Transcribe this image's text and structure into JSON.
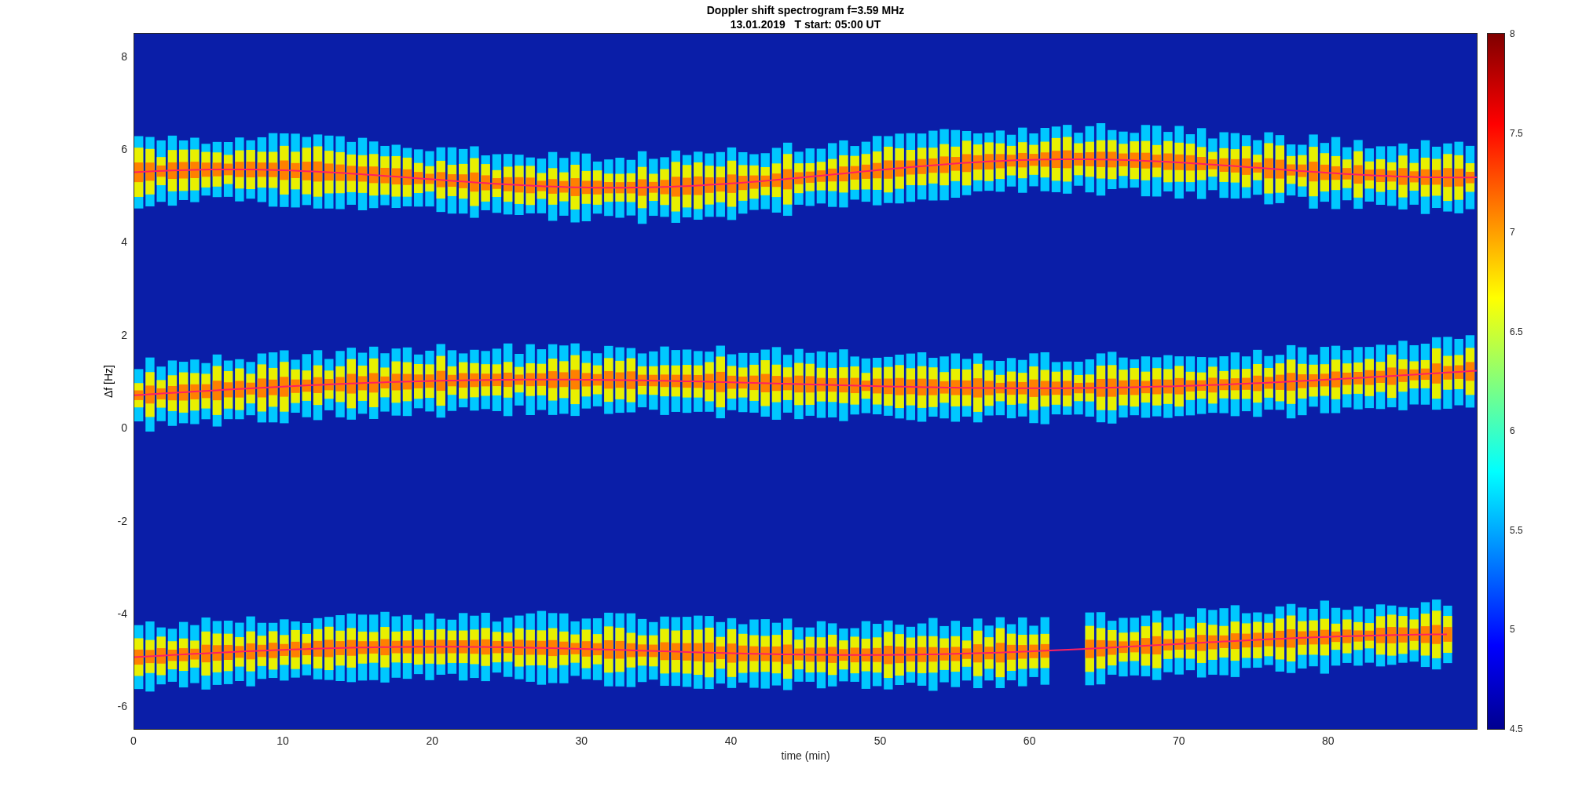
{
  "figure": {
    "title": "Doppler shift spectrogram f=3.59 MHz",
    "subtitle": "13.01.2019   T start: 05:00 UT",
    "xlabel": "time (min)",
    "ylabel": "Δf [Hz]",
    "xticks": [
      "0",
      "10",
      "20",
      "30",
      "40",
      "50",
      "60",
      "70",
      "80"
    ],
    "yticks": [
      "8",
      "6",
      "4",
      "2",
      "0",
      "-2",
      "-4",
      "-6"
    ],
    "colorbar_ticks": [
      "8",
      "7.5",
      "7",
      "6.5",
      "6",
      "5.5",
      "5",
      "4.5"
    ]
  }
}
